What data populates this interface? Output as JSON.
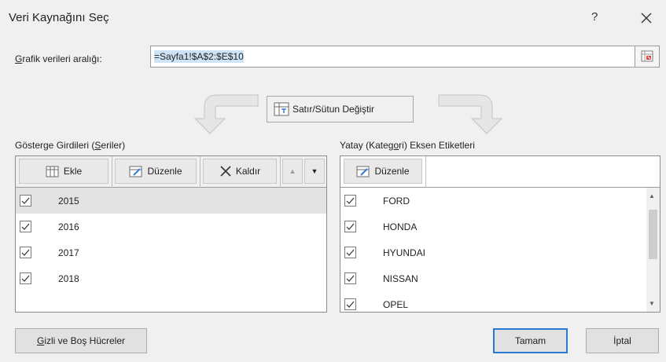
{
  "dialog": {
    "title": "Veri Kaynağını Seç",
    "help_glyph": "?",
    "close_icon": "close-icon"
  },
  "range": {
    "label": "Grafik verileri aralığı:",
    "value": "=Sayfa1!$A$2:$E$10"
  },
  "switch_button": {
    "label": "Satır/Sütun Değiştir"
  },
  "series_panel": {
    "label": "Gösterge Girdileri (Seriler)",
    "toolbar": {
      "add": "Ekle",
      "edit": "Düzenle",
      "remove": "Kaldır",
      "up_glyph": "▲",
      "down_glyph": "▼"
    },
    "items": [
      {
        "label": "2015",
        "checked": true,
        "selected": true
      },
      {
        "label": "2016",
        "checked": true,
        "selected": false
      },
      {
        "label": "2017",
        "checked": true,
        "selected": false
      },
      {
        "label": "2018",
        "checked": true,
        "selected": false
      }
    ]
  },
  "category_panel": {
    "label": "Yatay (Kategori) Eksen Etiketleri",
    "toolbar": {
      "edit": "Düzenle"
    },
    "items": [
      {
        "label": "FORD",
        "checked": true
      },
      {
        "label": "HONDA",
        "checked": true
      },
      {
        "label": "HYUNDAI",
        "checked": true
      },
      {
        "label": "NISSAN",
        "checked": true
      },
      {
        "label": "OPEL",
        "checked": true
      }
    ],
    "scroll_up_glyph": "▲",
    "scroll_down_glyph": "▼"
  },
  "footer": {
    "hidden_cells": "Gizli ve Boş Hücreler",
    "ok": "Tamam",
    "cancel": "İptal"
  },
  "colors": {
    "accent": "#2a7ad4",
    "selection": "#cfe3f7",
    "background": "#f0f0f0"
  }
}
